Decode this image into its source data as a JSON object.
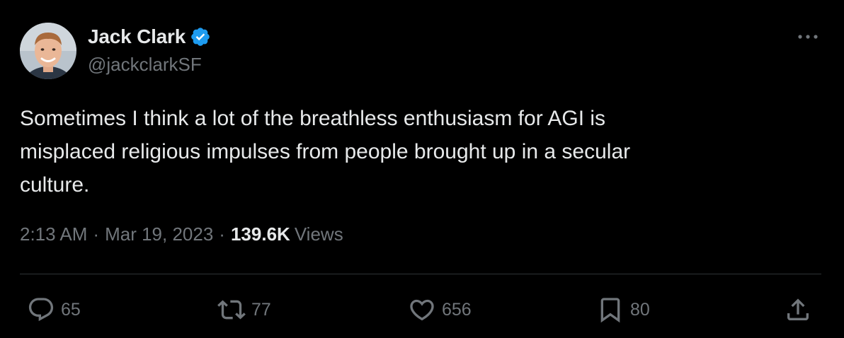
{
  "author": {
    "name": "Jack Clark",
    "handle": "@jackclarkSF",
    "verified": true
  },
  "tweet": {
    "text": "Sometimes I think a lot of the breathless enthusiasm for AGI is\nmisplaced religious impulses from people brought up in a secular\nculture.",
    "time": "2:13 AM",
    "separator": "·",
    "date": "Mar 19, 2023",
    "views_count": "139.6K",
    "views_label": "Views"
  },
  "actions": {
    "replies": "65",
    "retweets": "77",
    "likes": "656",
    "bookmarks": "80"
  },
  "icons": {
    "verified": "verified-badge-icon",
    "more": "more-dots-icon",
    "reply": "reply-bubble-icon",
    "retweet": "retweet-icon",
    "like": "heart-icon",
    "bookmark": "bookmark-icon",
    "share": "share-icon"
  },
  "colors": {
    "background": "#000000",
    "text": "#e7e9ea",
    "muted": "#71767b",
    "verified": "#1d9bf0",
    "divider": "#2f3336"
  }
}
